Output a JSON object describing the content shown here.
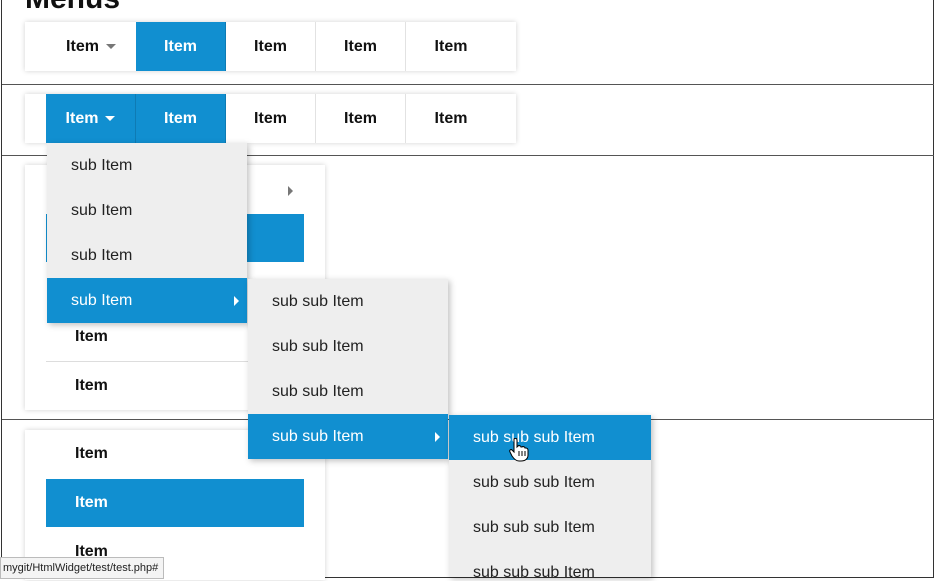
{
  "page": {
    "title": "Menus"
  },
  "menubar1": {
    "items": [
      {
        "label": "Item"
      },
      {
        "label": "Item"
      },
      {
        "label": "Item"
      },
      {
        "label": "Item"
      },
      {
        "label": "Item"
      }
    ]
  },
  "menubar2": {
    "items": [
      {
        "label": "Item"
      },
      {
        "label": "Item"
      },
      {
        "label": "Item"
      },
      {
        "label": "Item"
      },
      {
        "label": "Item"
      }
    ]
  },
  "vmenu1": {
    "items": [
      {
        "label": "Item"
      },
      {
        "label": "Item"
      }
    ]
  },
  "vmenu2": {
    "items": [
      {
        "label": "Item"
      },
      {
        "label": "Item"
      },
      {
        "label": "Item"
      }
    ]
  },
  "submenu1": {
    "items": [
      {
        "label": "sub Item"
      },
      {
        "label": "sub Item"
      },
      {
        "label": "sub Item"
      },
      {
        "label": "sub Item"
      }
    ]
  },
  "submenu2": {
    "items": [
      {
        "label": "sub sub Item"
      },
      {
        "label": "sub sub Item"
      },
      {
        "label": "sub sub Item"
      },
      {
        "label": "sub sub Item"
      }
    ]
  },
  "submenu3": {
    "items": [
      {
        "label": "sub sub sub Item"
      },
      {
        "label": "sub sub sub Item"
      },
      {
        "label": "sub sub sub Item"
      },
      {
        "label": "sub sub sub Item"
      }
    ]
  },
  "status": {
    "url": "mygit/HtmlWidget/test/test.php#"
  },
  "colors": {
    "accent": "#118fd0",
    "dropdown_bg": "#eeeeee",
    "separator": "#555555"
  },
  "icons": {
    "caret": "caret-down-icon",
    "submenu": "caret-right-icon",
    "cursor": "hand-pointer-icon"
  }
}
